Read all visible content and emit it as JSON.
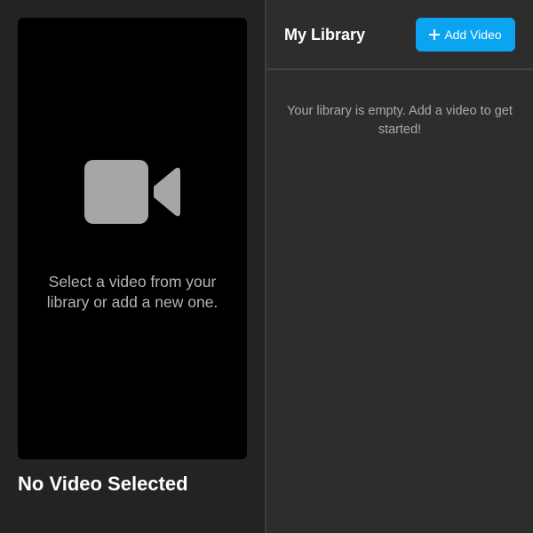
{
  "player": {
    "placeholder": "Select a video from your library or add a new one.",
    "title": "No Video Selected",
    "icon": "video-camera-icon"
  },
  "library": {
    "title": "My Library",
    "add_button_label": "Add Video",
    "add_button_icon": "plus-icon",
    "empty_message": "Your library is empty. Add a video to get started!"
  },
  "colors": {
    "accent": "#0aa4f0",
    "player_background": "#000000",
    "app_background": "#232323",
    "library_background": "#2d2d2d"
  }
}
